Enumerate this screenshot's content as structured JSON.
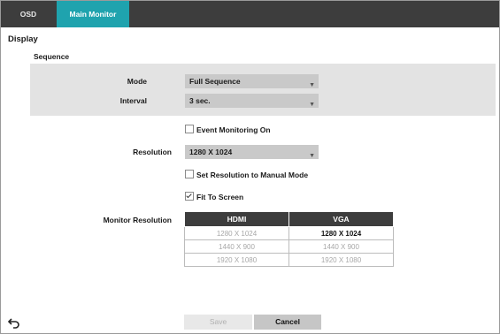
{
  "tabs": [
    {
      "label": "OSD",
      "active": false
    },
    {
      "label": "Main Monitor",
      "active": true
    }
  ],
  "section_title": "Display",
  "sequence": {
    "title": "Sequence",
    "mode_label": "Mode",
    "mode_value": "Full Sequence",
    "interval_label": "Interval",
    "interval_value": "3 sec."
  },
  "event_monitoring": {
    "label": "Event Monitoring On",
    "checked": false
  },
  "resolution": {
    "label": "Resolution",
    "value": "1280 X 1024"
  },
  "manual_mode": {
    "label": "Set Resolution to Manual Mode",
    "checked": false
  },
  "fit_to_screen": {
    "label": "Fit To Screen",
    "checked": true
  },
  "monitor_resolution": {
    "label": "Monitor Resolution",
    "columns": [
      "HDMI",
      "VGA"
    ],
    "rows": [
      [
        "1280 X 1024",
        "1280 X 1024"
      ],
      [
        "1440 X 900",
        "1440 X 900"
      ],
      [
        "1920 X 1080",
        "1920 X 1080"
      ]
    ],
    "selected": {
      "row": 0,
      "col": 1
    }
  },
  "buttons": {
    "save": "Save",
    "cancel": "Cancel"
  },
  "icons": {
    "back": "back-arrow-icon",
    "dropdown": "chevron-down-icon",
    "checkbox": "checkbox-icon"
  },
  "colors": {
    "tab_bar": "#3d3d3d",
    "active_tab": "#1fa3ae",
    "panel": "#e3e3e3",
    "dropdown": "#c9c9c9"
  }
}
